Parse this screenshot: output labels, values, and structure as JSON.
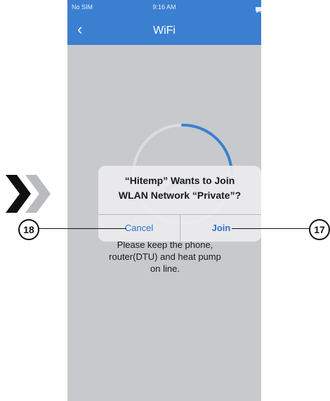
{
  "status_bar": {
    "carrier": "No SIM",
    "time": "9:16 AM",
    "battery": "90%"
  },
  "nav": {
    "back_icon": "‹",
    "title": "WiFi"
  },
  "spinner": {
    "progress": 0.25
  },
  "alert": {
    "title": "“Hitemp” Wants to Join\nWLAN Network “Private”?",
    "cancel": "Cancel",
    "join": "Join"
  },
  "info_text": "Please keep the phone,\nrouter(DTU) and heat pump\non line.",
  "annotations": {
    "left": "18",
    "right": "17"
  },
  "colors": {
    "nav": "#3b7fd1",
    "overlay": "#c7c9cc",
    "accent": "#2f72c8"
  }
}
